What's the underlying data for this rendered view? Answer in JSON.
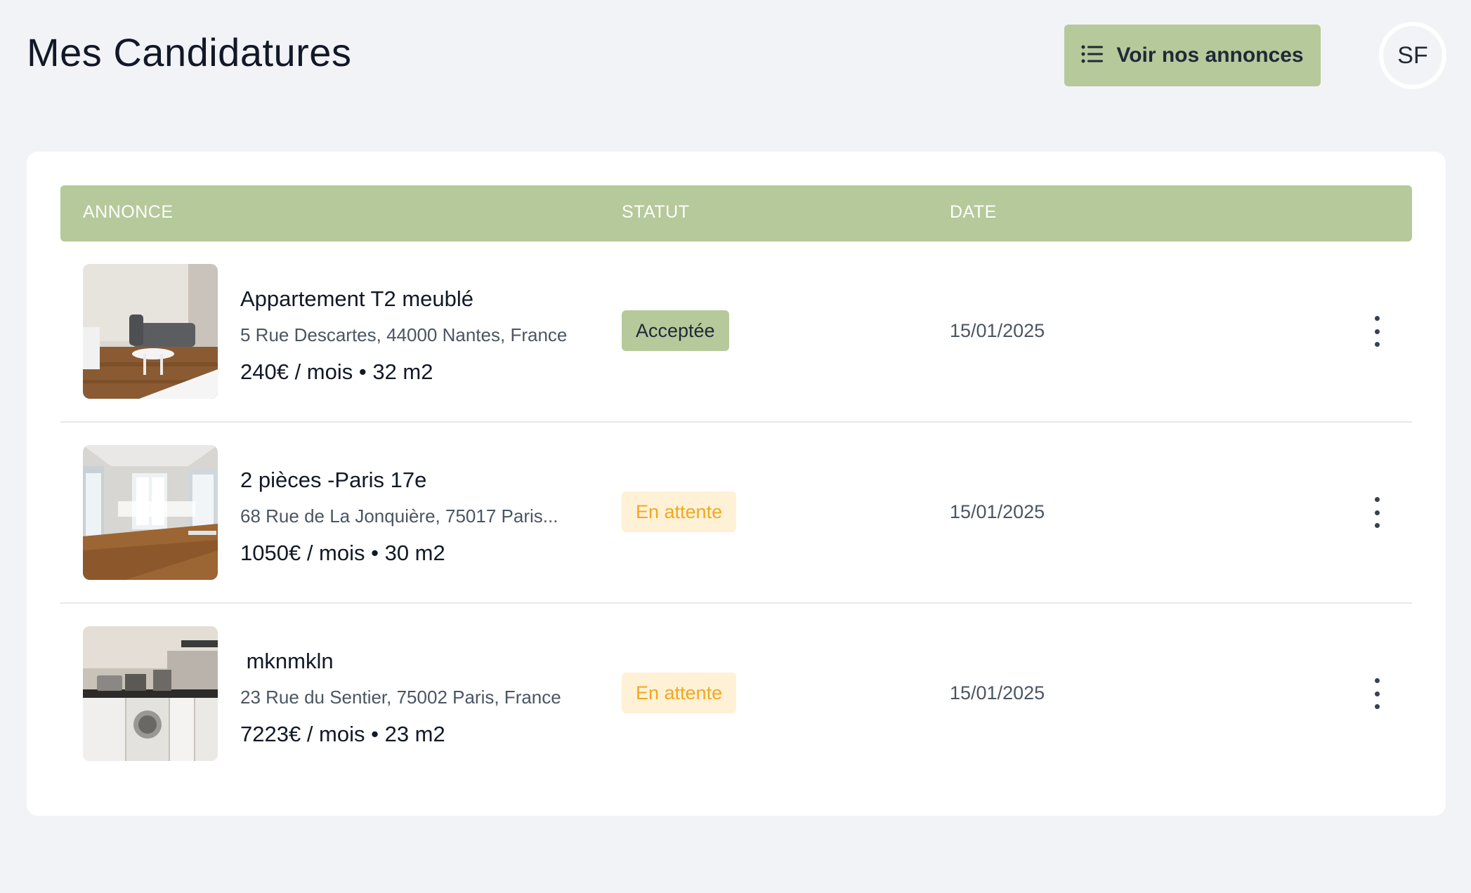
{
  "header": {
    "title": "Mes Candidatures",
    "cta_label": "Voir nos annonces",
    "cta_icon": "list-icon",
    "avatar_initials": "SF"
  },
  "table": {
    "columns": [
      "ANNONCE",
      "STATUT",
      "DATE"
    ],
    "rows": [
      {
        "title": "Appartement T2 meublé",
        "address": "5 Rue Descartes, 44000 Nantes, France",
        "price": "240€ / mois • 32 m2",
        "status": "Acceptée",
        "date": "15/01/2025",
        "image": "living-room-photo"
      },
      {
        "title": "2 pièces -Paris 17e",
        "address": "68 Rue de La Jonquière, 75017 Paris...",
        "price": "1050€ / mois • 30 m2",
        "status": "En attente",
        "date": "15/01/2025",
        "image": "empty-room-photo"
      },
      {
        "title": " mknmkln",
        "address": "23 Rue du Sentier, 75002 Paris, France",
        "price": "7223€ / mois • 23 m2",
        "status": "En attente",
        "date": "15/01/2025",
        "image": "kitchen-photo"
      }
    ]
  },
  "colors": {
    "accent": "#b5c99a",
    "pending_bg": "#fff1d6",
    "pending_text": "#f0a820",
    "page_bg": "#f2f3f7"
  }
}
